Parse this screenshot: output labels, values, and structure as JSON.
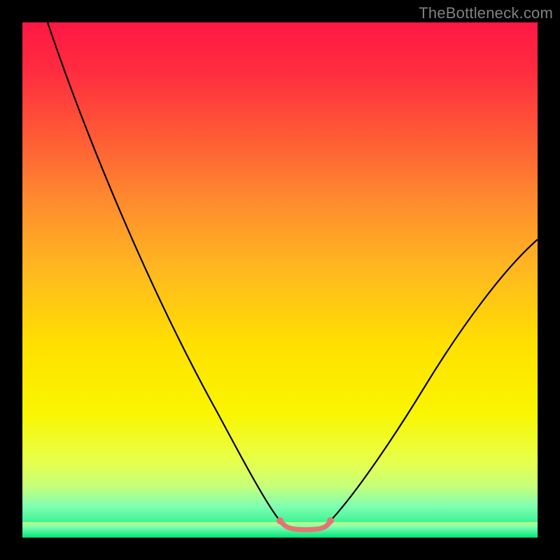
{
  "watermark": {
    "text": "TheBottleneck.com"
  },
  "colors": {
    "curve_stroke": "#000000",
    "pink_stroke": "#e57373",
    "pink_fill": "#e57373",
    "gradient_top": "#ff1744",
    "gradient_mid": "#ffe100",
    "gradient_bottom": "#00e676",
    "frame": "#000000",
    "watermark": "#808080"
  },
  "chart_data": {
    "type": "line",
    "title": "",
    "xlabel": "",
    "ylabel": "",
    "xlim": [
      0,
      100
    ],
    "ylim": [
      0,
      100
    ],
    "series": [
      {
        "name": "bottleneck-curve",
        "x": [
          5,
          10,
          15,
          20,
          25,
          30,
          35,
          40,
          45,
          48,
          50,
          52,
          54,
          56,
          58,
          60,
          65,
          70,
          75,
          80,
          85,
          90,
          95,
          100
        ],
        "y": [
          100,
          90,
          80,
          70,
          60,
          50,
          40,
          30,
          20,
          10,
          4,
          2,
          2,
          2,
          2,
          4,
          10,
          18,
          27,
          35,
          42,
          48,
          53,
          57
        ]
      }
    ],
    "optimal_region": {
      "x_start": 50,
      "x_end": 60,
      "y": 2
    },
    "background_gradient_desc": "vertical red→orange→yellow→green heatmap, green=optimal (low bottleneck)"
  }
}
